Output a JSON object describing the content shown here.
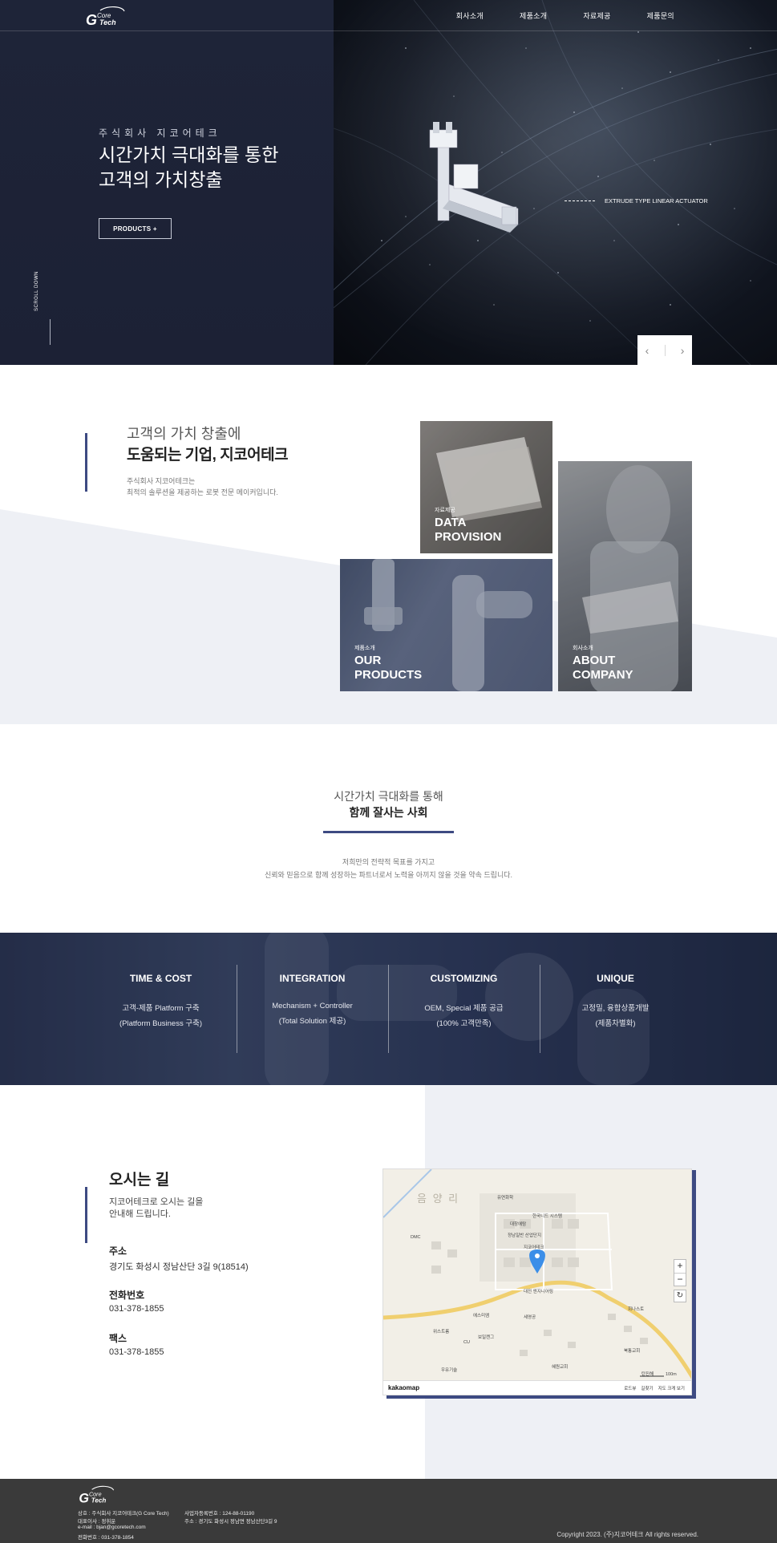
{
  "header": {
    "logo_text_1": "Core",
    "logo_text_2": "Tech",
    "nav": [
      "회사소개",
      "제품소개",
      "자료제공",
      "제품문의"
    ]
  },
  "hero": {
    "eyebrow": "주식회사 지코어테크",
    "title_line1": "시간가치 극대화를 통한",
    "title_line2": "고객의 가치창출",
    "button": "PRODUCTS +",
    "scroll": "SCROLL DOWN",
    "product_caption": "EXTRUDE TYPE LINEAR ACTUATOR",
    "prev": "‹",
    "next": "›"
  },
  "intro": {
    "title_line1": "고객의 가치 창출에",
    "title_line2": "도움되는 기업, 지코어테크",
    "desc_line1": "주식회사 지코어테크는",
    "desc_line2": "최적의 솔루션을 제공하는 로봇 전문 메이커입니다.",
    "tiles": [
      {
        "sub": "자료제공",
        "title": "DATA\nPROVISION"
      },
      {
        "sub": "제품소개",
        "title": "OUR\nPRODUCTS"
      },
      {
        "sub": "회사소개",
        "title": "ABOUT\nCOMPANY"
      }
    ]
  },
  "vision": {
    "title_line1": "시간가치 극대화를 통해",
    "title_line2": "함께 잘사는 사회",
    "desc_line1": "저희만의 전략적 목표를 가지고",
    "desc_line2": "신뢰와 믿음으로 함께 성장하는 파트너로서 노력을 아끼지 않을 것을 약속 드립니다."
  },
  "features": [
    {
      "title": "TIME & COST",
      "line1": "고객-제품 Platform 구축",
      "line2": "(Platform Business 구축)"
    },
    {
      "title": "INTEGRATION",
      "line1": "Mechanism + Controller",
      "line2": "(Total Solution 제공)"
    },
    {
      "title": "CUSTOMIZING",
      "line1": "OEM, Special 제품 공급",
      "line2": "(100% 고객만족)"
    },
    {
      "title": "UNIQUE",
      "line1": "고정밀, 융합상품개발",
      "line2": "(제품차별화)"
    }
  ],
  "location": {
    "title": "오시는 길",
    "sub_line1": "지코어테크로 오시는 길을",
    "sub_line2": "안내해 드립니다.",
    "address_label": "주소",
    "address": "경기도 화성시 정남산단 3길 9(18514)",
    "phone_label": "전화번호",
    "phone": "031-378-1855",
    "fax_label": "팩스",
    "fax": "031-378-1855",
    "map": {
      "region": "음 양 리",
      "brand": "kakaomap",
      "links": [
        "로드뷰",
        "길찾기",
        "지도 크게 보기"
      ],
      "scale": "100m",
      "labels": [
        "유연화학",
        "대창에탐",
        "한국니드 시스템",
        "정남일반 산업단지",
        "지코어테크",
        "대전 엔지니어링",
        "DMC",
        "위스트룸",
        "세영공",
        "회나스토",
        "에스미엠",
        "CU",
        "보일켄그",
        "우유기술",
        "북통교회",
        "혜원교회",
        "탄진해"
      ]
    }
  },
  "footer": {
    "logo_text_1": "Core",
    "logo_text_2": "Tech",
    "company": "상호 : 주식회사 지코어테크(G Core Tech)",
    "ceo": "대표이사 : 정휘운",
    "email": "e-mail : bjan@gcoretech.com",
    "tel": "전화번호 : 031-378-1854",
    "biz_no": "사업자등록번호 : 124-88-01190",
    "address": "주소 : 경기도 화성시 정남면 정남산단3길 9",
    "copyright": "Copyright 2023. (주)지코어테크 All rights reserved."
  }
}
